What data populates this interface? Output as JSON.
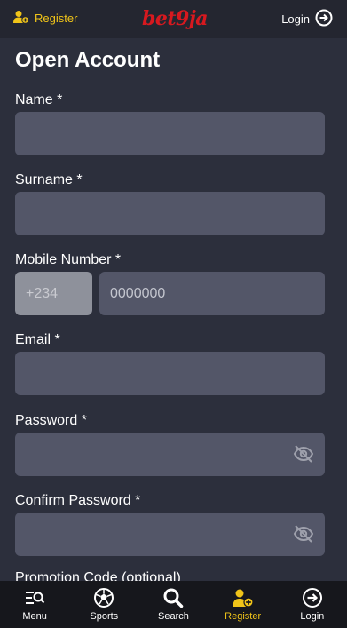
{
  "header": {
    "register_label": "Register",
    "logo_text": "bet9ja",
    "login_label": "Login"
  },
  "page": {
    "title": "Open Account"
  },
  "form": {
    "name_label": "Name *",
    "surname_label": "Surname *",
    "mobile_label": "Mobile Number *",
    "mobile_prefix": "+234",
    "mobile_placeholder": "0000000",
    "email_label": "Email *",
    "password_label": "Password *",
    "confirm_password_label": "Confirm Password *",
    "promo_label": "Promotion Code (optional)"
  },
  "bottom_nav": [
    {
      "label": "Menu",
      "icon": "menu-search-icon"
    },
    {
      "label": "Sports",
      "icon": "soccer-ball-icon"
    },
    {
      "label": "Search",
      "icon": "search-icon"
    },
    {
      "label": "Register",
      "icon": "add-user-icon"
    },
    {
      "label": "Login",
      "icon": "login-arrow-icon"
    }
  ],
  "colors": {
    "accent": "#f0c419",
    "brand": "#d7191f",
    "background": "#2c2f3c",
    "field": "#535668"
  }
}
